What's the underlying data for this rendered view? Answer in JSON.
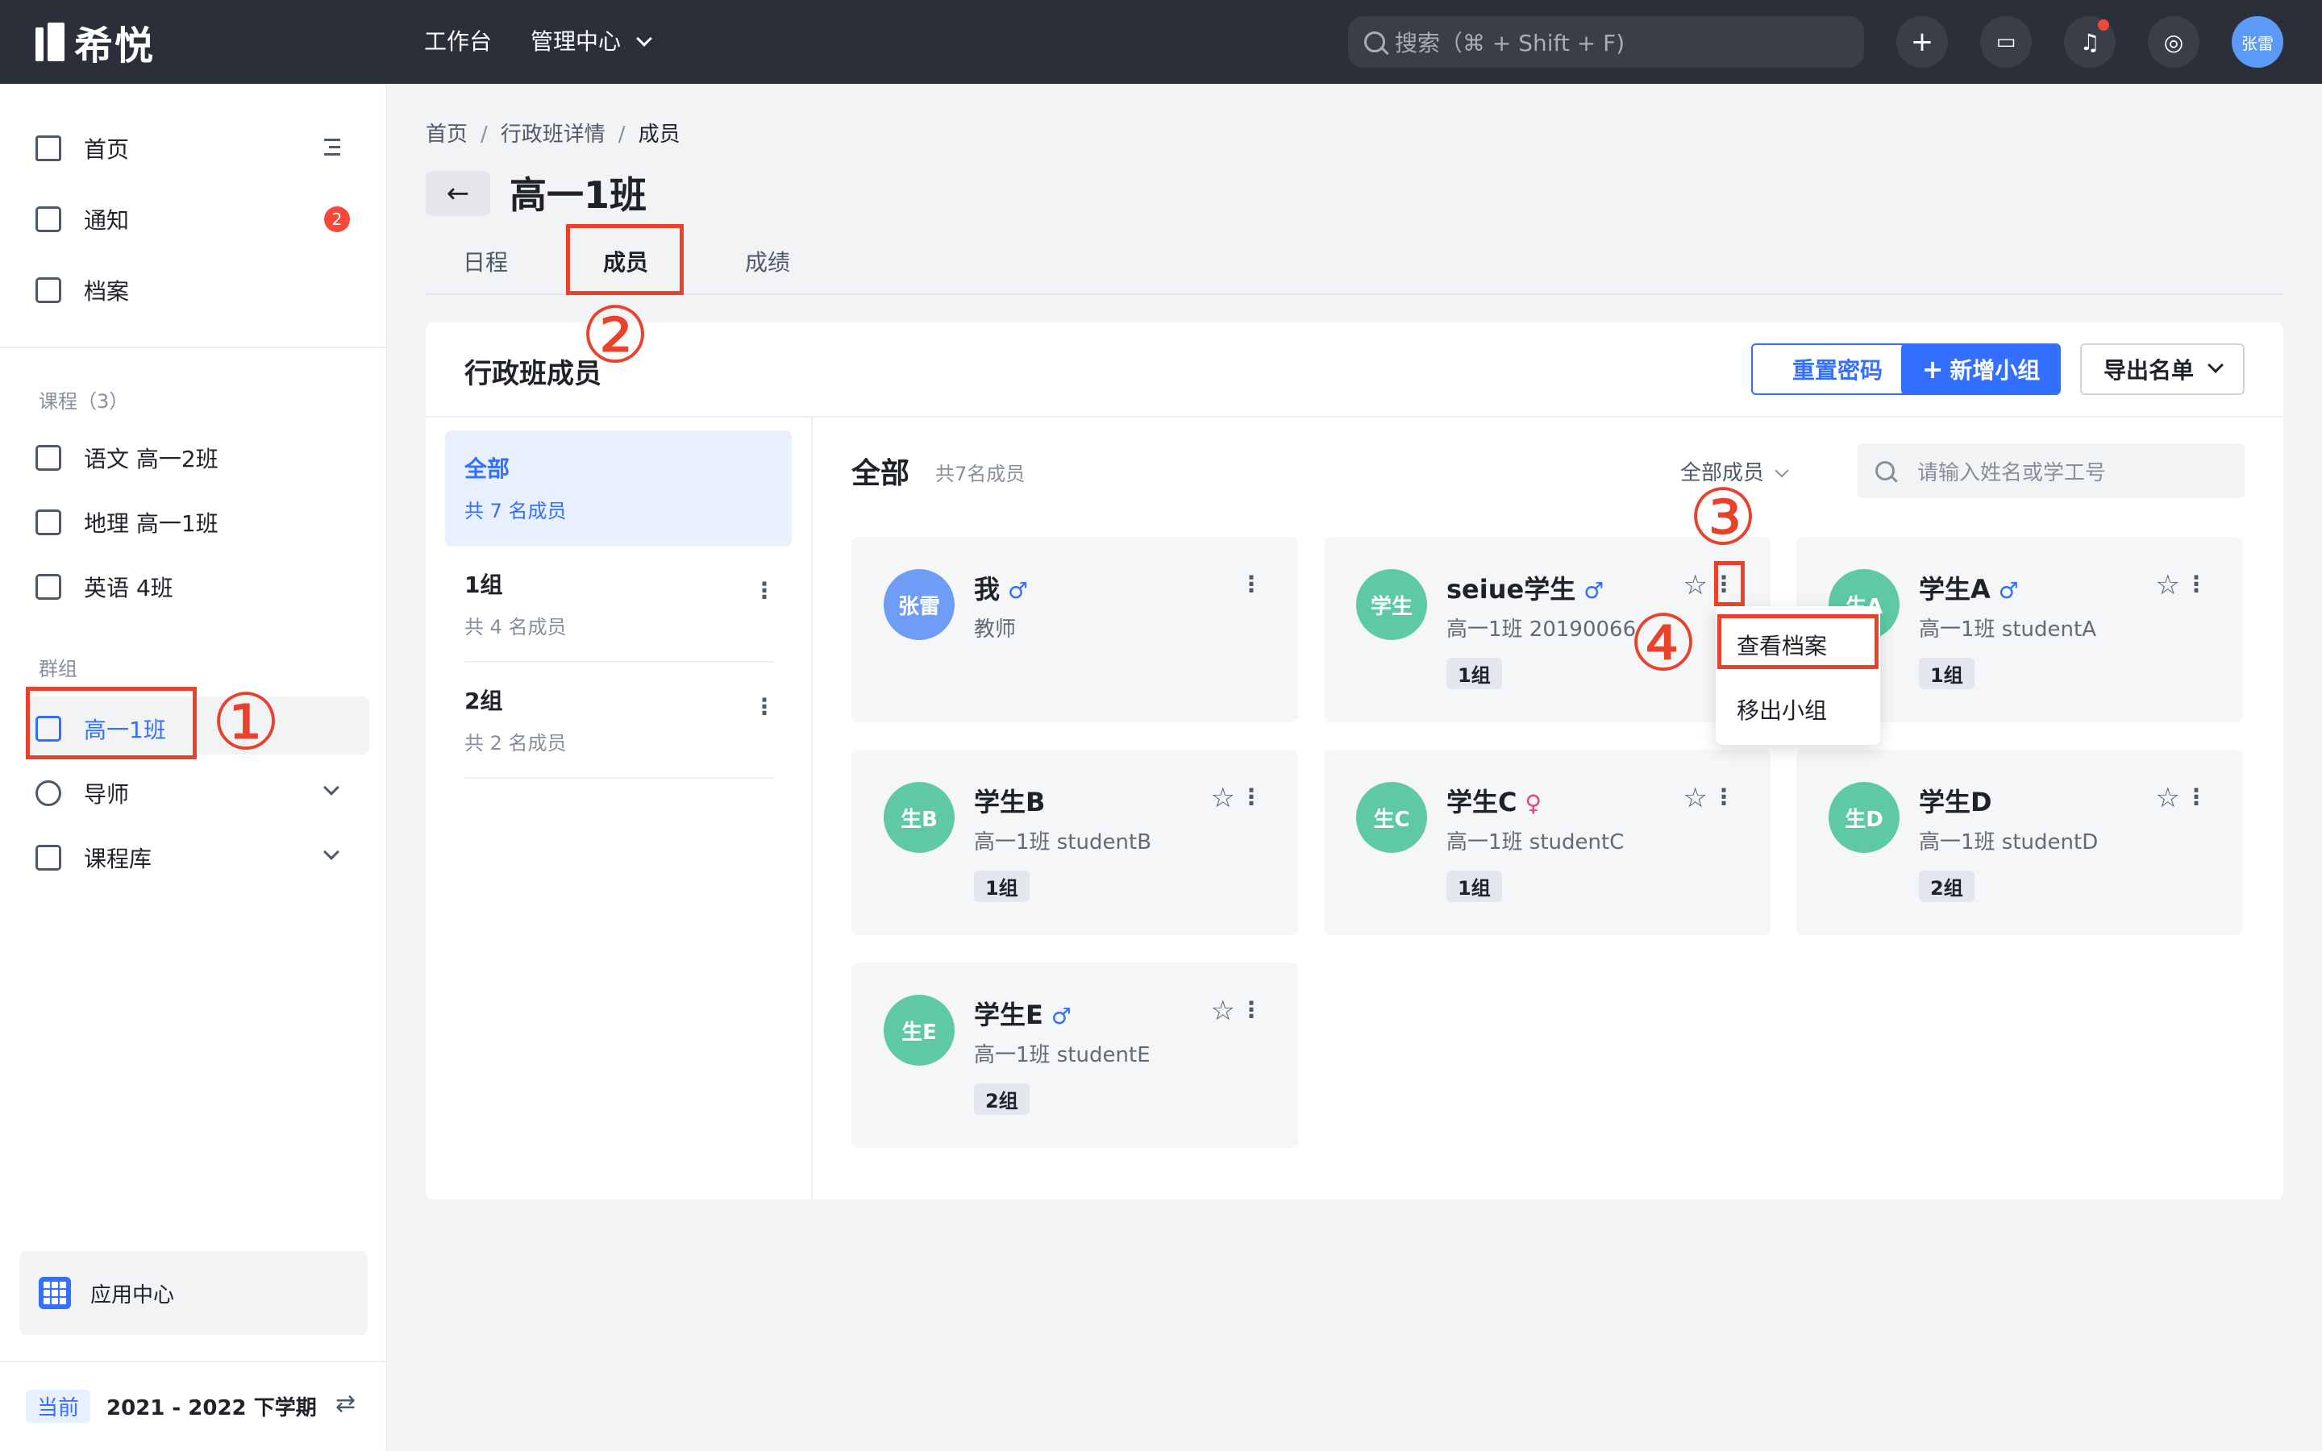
{
  "topbar": {
    "logo_text": "希悦",
    "nav": [
      {
        "label": "工作台"
      },
      {
        "label": "管理中心"
      }
    ],
    "search_placeholder": "搜索（⌘ + Shift + F)",
    "icons": [
      "plus-icon",
      "chat-icon",
      "bell-icon",
      "settings-icon"
    ],
    "user_initials": "张雷"
  },
  "sidebar": {
    "items": [
      {
        "label": "首页",
        "icon": "home-icon"
      },
      {
        "label": "通知",
        "icon": "message-icon",
        "badge": "2"
      },
      {
        "label": "档案",
        "icon": "archive-icon"
      }
    ],
    "courses_title": "课程（3）",
    "courses": [
      {
        "label": "语文 高一2班"
      },
      {
        "label": "地理 高一1班"
      },
      {
        "label": "英语 4班"
      }
    ],
    "groups_title": "群组",
    "groups": [
      {
        "label": "高一1班",
        "active": true
      },
      {
        "label": "导师",
        "expandable": true
      },
      {
        "label": "课程库",
        "expandable": true
      }
    ],
    "app_center": "应用中心",
    "term_tag": "当前",
    "term_label": "2021 - 2022 下学期"
  },
  "breadcrumb": [
    "首页",
    "行政班详情",
    "成员"
  ],
  "page_title": "高一1班",
  "tabs": [
    {
      "label": "日程"
    },
    {
      "label": "成员",
      "active": true
    },
    {
      "label": "成绩"
    }
  ],
  "panel": {
    "title": "行政班成员",
    "buttons": {
      "reset_password": "重置密码",
      "add_group": "新增小组",
      "export": "导出名单"
    },
    "groups": [
      {
        "name": "全部",
        "count": "共 7 名成员",
        "selected": true
      },
      {
        "name": "1组",
        "count": "共 4 名成员"
      },
      {
        "name": "2组",
        "count": "共 2 名成员"
      }
    ],
    "main_title": "全部",
    "main_count": "共7名成员",
    "filter_label": "全部成员",
    "search_placeholder": "请输入姓名或学工号",
    "members": [
      {
        "avatar": "张雷",
        "name": "我",
        "gender": "♂",
        "sub": "教师",
        "tag": "",
        "avatar_color": "#6f9cf5"
      },
      {
        "avatar": "学生",
        "name": "seiue学生",
        "gender": "♂",
        "sub": "高一1班 20190066",
        "tag": "1组",
        "avatar_color": "#5fc9a3"
      },
      {
        "avatar": "生A",
        "name": "学生A",
        "gender": "♂",
        "sub": "高一1班 studentA",
        "tag": "1组",
        "avatar_color": "#5fc9a3"
      },
      {
        "avatar": "生B",
        "name": "学生B",
        "gender": "",
        "sub": "高一1班 studentB",
        "tag": "1组",
        "avatar_color": "#5fc9a3"
      },
      {
        "avatar": "生C",
        "name": "学生C",
        "gender": "♀",
        "sub": "高一1班 studentC",
        "tag": "1组",
        "avatar_color": "#5fc9a3"
      },
      {
        "avatar": "生D",
        "name": "学生D",
        "gender": "",
        "sub": "高一1班 studentD",
        "tag": "2组",
        "avatar_color": "#5fc9a3"
      },
      {
        "avatar": "生E",
        "name": "学生E",
        "gender": "♂",
        "sub": "高一1班 studentE",
        "tag": "2组",
        "avatar_color": "#5fc9a3"
      }
    ],
    "context_menu": [
      "查看档案",
      "移出小组"
    ]
  },
  "annotations": [
    "①",
    "②",
    "③",
    "④"
  ],
  "colors": {
    "accent": "#3370ff",
    "annotation": "#e8412c",
    "topbar": "#2b2f3a"
  }
}
